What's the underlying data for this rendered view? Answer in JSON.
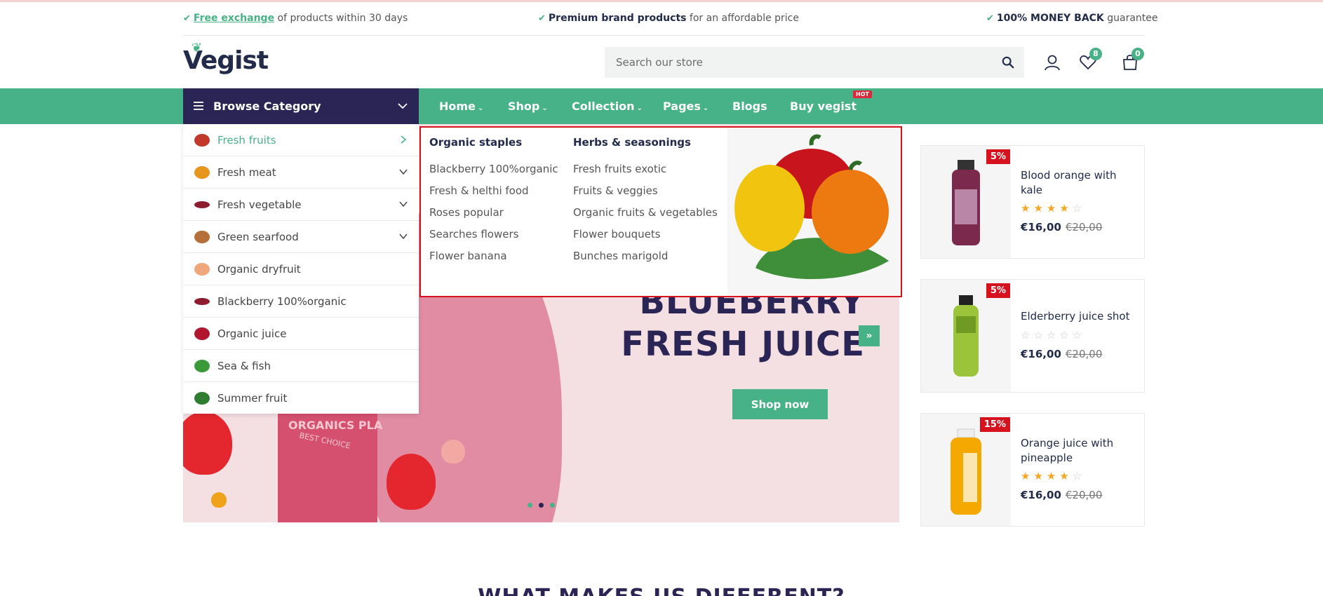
{
  "infobar": {
    "item1_link": "Free exchange",
    "item1_rest": " of products within 30 days",
    "item2_bold": "Premium brand products",
    "item2_rest": " for an affordable price",
    "item3_bold": "100% MONEY BACK",
    "item3_rest": " guarantee"
  },
  "header": {
    "logo": "Vegist",
    "search_placeholder": "Search our store",
    "wishlist_count": "8",
    "cart_count": "0"
  },
  "nav": {
    "browse_label": "Browse Category",
    "items": [
      "Home",
      "Shop",
      "Collection",
      "Pages",
      "Blogs",
      "Buy vegist"
    ],
    "hot_badge": "HOT"
  },
  "categories": [
    {
      "label": "Fresh fruits",
      "icon": "crab-icon"
    },
    {
      "label": "Fresh meat",
      "icon": "fruit-icon"
    },
    {
      "label": "Fresh vegetable",
      "icon": "berry-icon"
    },
    {
      "label": "Green searfood",
      "icon": "seafood-icon"
    },
    {
      "label": "Organic dryfruit",
      "icon": "peach-icon"
    },
    {
      "label": "Blackberry 100%organic",
      "icon": "berry-icon"
    },
    {
      "label": "Organic juice",
      "icon": "cherry-icon"
    },
    {
      "label": "Sea & fish",
      "icon": "watermelon-icon"
    },
    {
      "label": "Summer fruit",
      "icon": "broccoli-icon"
    }
  ],
  "mega": {
    "col1_title": "Organic staples",
    "col1_links": [
      "Blackberry 100%organic",
      "Fresh & helthi food",
      "Roses popular",
      "Searches flowers",
      "Flower banana"
    ],
    "col2_title": "Herbs & seasonings",
    "col2_links": [
      "Fresh fruits exotic",
      "Fruits & veggies",
      "Organic fruits & vegetables",
      "Flower bouquets",
      "Bunches marigold"
    ]
  },
  "hero": {
    "title_line1": "BLUEBERRY",
    "title_line2": "FRESH JUICE",
    "button": "Shop now",
    "bottle_text": "ORGANICS PLA",
    "bottle_sub": "BEST CHOICE",
    "slide_count": 3,
    "active_slide": 2
  },
  "products": [
    {
      "discount": "5%",
      "name": "Blood orange with kale",
      "rating": 4,
      "price": "€16,00",
      "old_price": "€20,00"
    },
    {
      "discount": "5%",
      "name": "Elderberry juice shot",
      "rating": 0,
      "price": "€16,00",
      "old_price": "€20,00"
    },
    {
      "discount": "15%",
      "name": "Orange juice with pineapple",
      "rating": 4,
      "price": "€16,00",
      "old_price": "€20,00"
    }
  ],
  "section_title": "WHAT MAKES US DIFFERENT?",
  "colors": {
    "brand_green": "#47b187",
    "brand_navy": "#2b2555",
    "sale_red": "#d6121f"
  }
}
